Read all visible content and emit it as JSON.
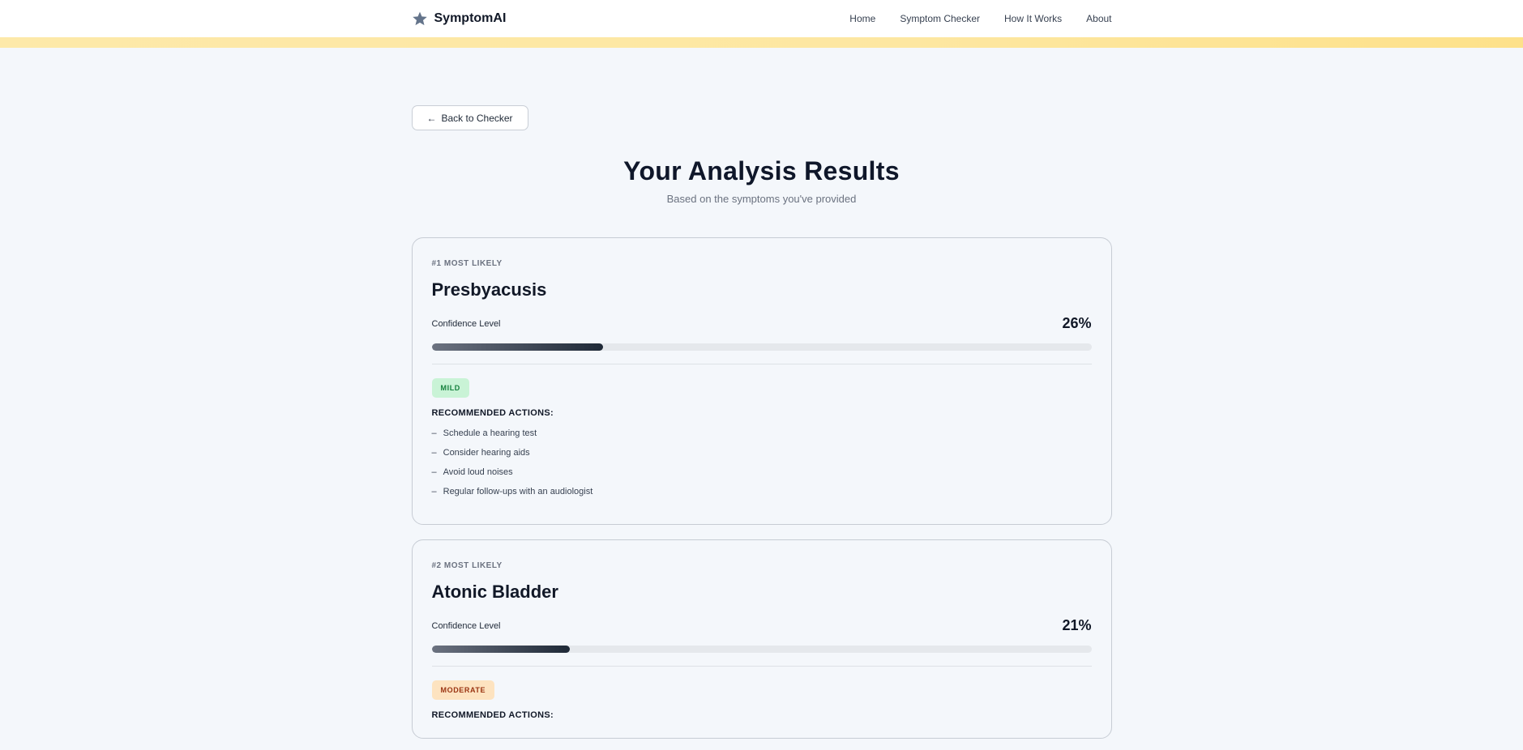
{
  "nav": {
    "brand": "SymptomAI",
    "links": [
      "Home",
      "Symptom Checker",
      "How It Works",
      "About"
    ]
  },
  "back_label": "Back to Checker",
  "title": "Your Analysis Results",
  "subtitle": "Based on the symptoms you've provided",
  "results": [
    {
      "rank": "#1 MOST LIKELY",
      "name": "Presbyacusis",
      "confidence_label": "Confidence Level",
      "confidence": "26%",
      "confidence_value": 26,
      "severity": "MILD",
      "actions_title": "RECOMMENDED ACTIONS:",
      "actions": [
        "Schedule a hearing test",
        "Consider hearing aids",
        "Avoid loud noises",
        "Regular follow-ups with an audiologist"
      ]
    },
    {
      "rank": "#2 MOST LIKELY",
      "name": "Atonic Bladder",
      "confidence_label": "Confidence Level",
      "confidence": "21%",
      "confidence_value": 21,
      "severity": "MODERATE",
      "actions_title": "RECOMMENDED ACTIONS:",
      "actions": []
    }
  ],
  "colors": {
    "banner": "#fde7a1",
    "mild_badge": "#c9f3d6",
    "moderate_badge": "#fde3c0"
  }
}
